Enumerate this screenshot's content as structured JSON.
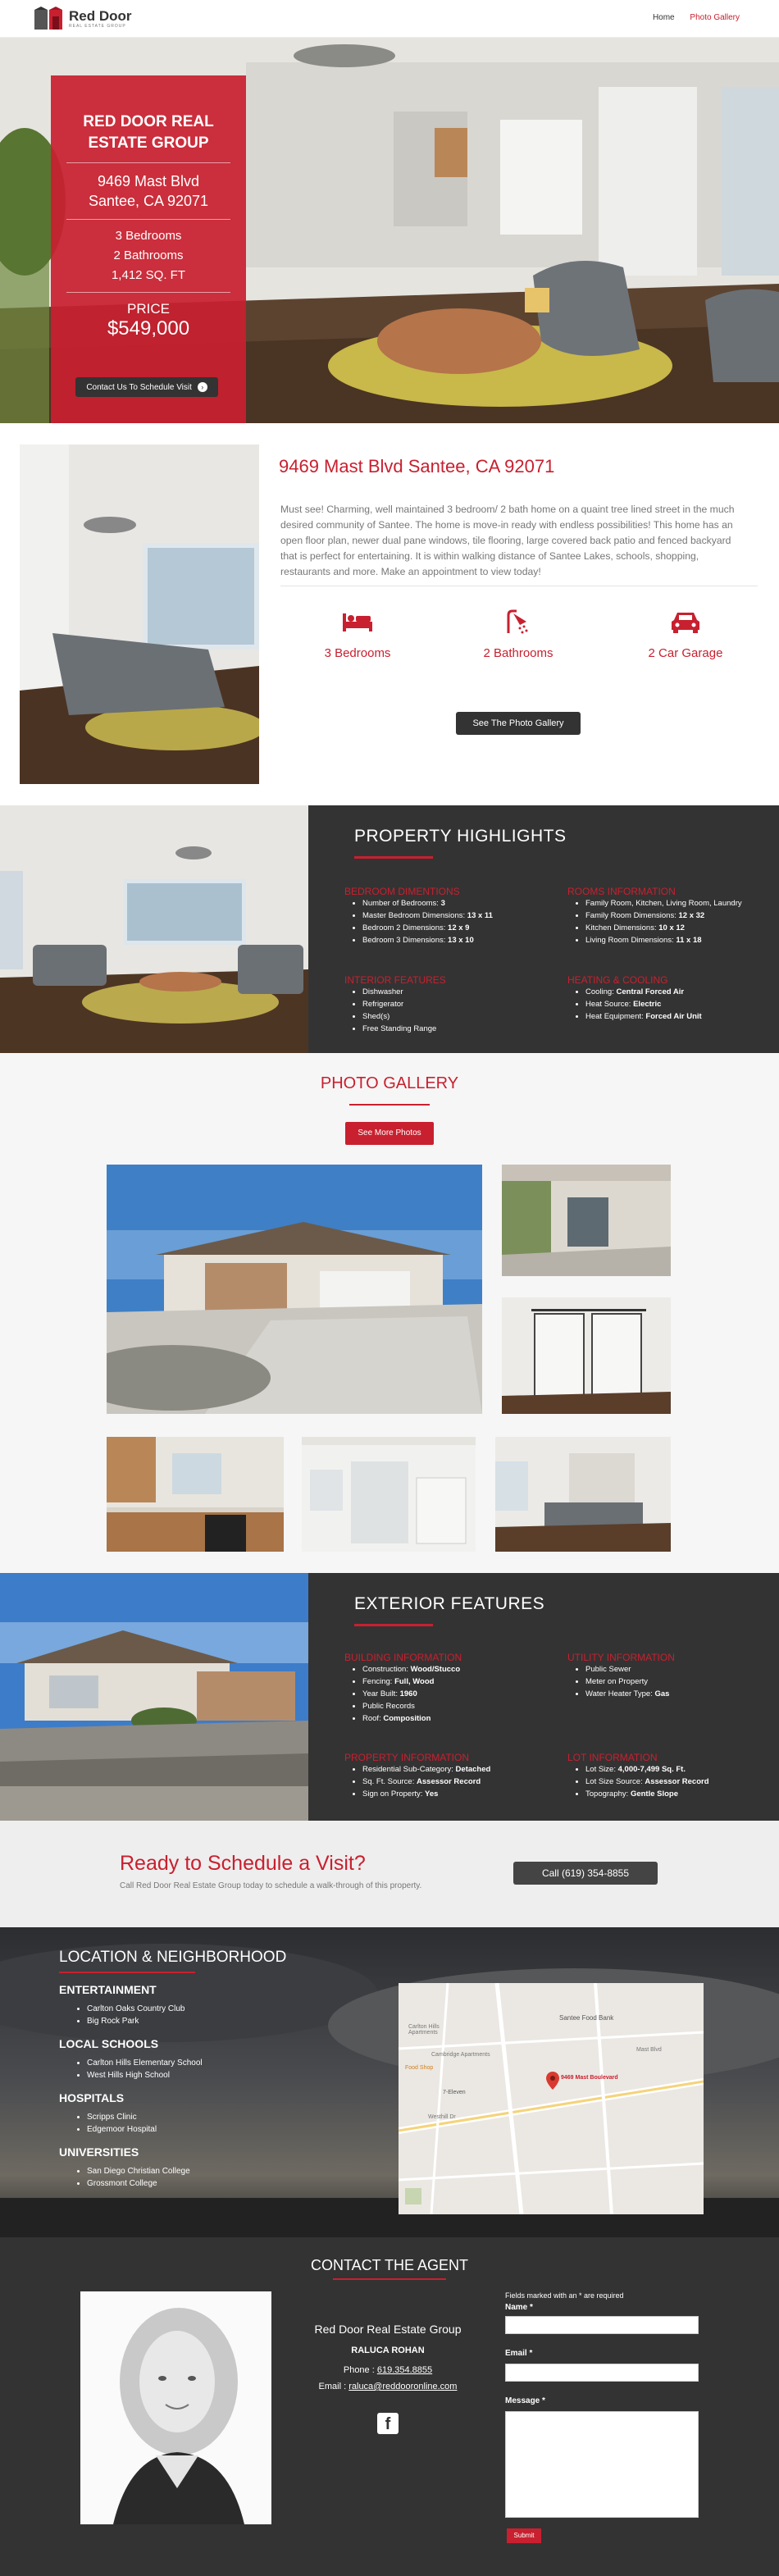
{
  "header": {
    "logo_text": "Red Door",
    "logo_sub": "REAL ESTATE GROUP",
    "nav": [
      "Home",
      "Photo Gallery"
    ]
  },
  "hero": {
    "title": "RED DOOR REAL ESTATE GROUP",
    "address_line1": "9469 Mast Blvd",
    "address_line2": "Santee, CA 92071",
    "beds": "3 Bedrooms",
    "baths": "2 Bathrooms",
    "sqft": "1,412 SQ. FT",
    "price_label": "PRICE",
    "price": "$549,000",
    "button": "Contact Us To Schedule Visit"
  },
  "overview": {
    "address": "9469 Mast Blvd Santee, CA 92071",
    "description": "Must see! Charming, well maintained 3 bedroom/ 2 bath home on a quaint tree lined street in the much desired community of Santee. The home is move-in ready with endless possibilities! This home has an open floor plan, newer dual pane windows, tile flooring, large covered back patio and fenced backyard that is perfect for entertaining. It is within walking distance of Santee Lakes, schools, shopping, restaurants and more. Make an appointment to view today!",
    "features": [
      {
        "icon": "bed-icon",
        "label": "3 Bedrooms"
      },
      {
        "icon": "shower-icon",
        "label": "2 Bathrooms"
      },
      {
        "icon": "car-icon",
        "label": "2 Car Garage"
      }
    ],
    "gallery_button": "See The Photo Gallery"
  },
  "highlights": {
    "title": "PROPERTY HIGHLIGHTS",
    "bedroom_dims": {
      "title": "BEDROOM DIMENTIONS",
      "items": [
        {
          "label": "Number of Bedrooms:",
          "value": "3"
        },
        {
          "label": "Master Bedroom Dimensions:",
          "value": "13 x 11"
        },
        {
          "label": "Bedroom 2 Dimensions:",
          "value": "12 x 9"
        },
        {
          "label": "Bedroom 3 Dimensions:",
          "value": "13 x 10"
        }
      ]
    },
    "rooms_info": {
      "title": "ROOMS INFORMATION",
      "items": [
        {
          "label": "Family Room, Kitchen, Living Room, Laundry",
          "value": ""
        },
        {
          "label": "Family Room Dimensions:",
          "value": "12 x 32"
        },
        {
          "label": "Kitchen Dimensions:",
          "value": "10 x 12"
        },
        {
          "label": "Living Room Dimensions:",
          "value": "11 x 18"
        }
      ]
    },
    "interior": {
      "title": "INTERIOR FEATURES",
      "items": [
        "Dishwasher",
        "Refrigerator",
        "Shed(s)",
        "Free Standing Range"
      ]
    },
    "heating": {
      "title": "HEATING & COOLING",
      "items": [
        {
          "label": "Cooling:",
          "value": "Central Forced Air"
        },
        {
          "label": "Heat Source:",
          "value": "Electric"
        },
        {
          "label": "Heat Equipment:",
          "value": "Forced Air Unit"
        }
      ]
    }
  },
  "gallery": {
    "title": "PHOTO GALLERY",
    "button": "See More Photos"
  },
  "exterior": {
    "title": "EXTERIOR FEATURES",
    "building": {
      "title": "BUILDING INFORMATION",
      "items": [
        {
          "label": "Construction:",
          "value": "Wood/Stucco"
        },
        {
          "label": "Fencing:",
          "value": "Full, Wood"
        },
        {
          "label": "Year Built:",
          "value": "1960"
        },
        {
          "label": "Public Records",
          "value": ""
        },
        {
          "label": "Roof:",
          "value": "Composition"
        }
      ]
    },
    "utility": {
      "title": "UTILITY INFORMATION",
      "items": [
        {
          "label": "Public Sewer",
          "value": ""
        },
        {
          "label": "Meter on Property",
          "value": ""
        },
        {
          "label": "Water Heater Type:",
          "value": "Gas"
        }
      ]
    },
    "property": {
      "title": "PROPERTY INFORMATION",
      "items": [
        {
          "label": "Residential Sub-Category:",
          "value": "Detached"
        },
        {
          "label": "Sq. Ft. Source:",
          "value": "Assessor Record"
        },
        {
          "label": "Sign on Property:",
          "value": "Yes"
        }
      ]
    },
    "lot": {
      "title": "LOT INFORMATION",
      "items": [
        {
          "label": "Lot Size:",
          "value": "4,000-7,499 Sq. Ft."
        },
        {
          "label": "Lot Size Source:",
          "value": "Assessor Record"
        },
        {
          "label": "Topography:",
          "value": "Gentle Slope"
        }
      ]
    }
  },
  "cta": {
    "title": "Ready to Schedule a Visit?",
    "subtitle": "Call Red Door Real Estate Group today to schedule a walk-through of this property.",
    "button": "Call (619) 354-8855"
  },
  "location": {
    "title": "LOCATION & NEIGHBORHOOD",
    "groups": [
      {
        "title": "ENTERTAINMENT",
        "items": [
          "Carlton Oaks Country Club",
          "Big Rock Park"
        ]
      },
      {
        "title": "LOCAL SCHOOLS",
        "items": [
          "Carlton Hills Elementary School",
          "West Hills High School"
        ]
      },
      {
        "title": "HOSPITALS",
        "items": [
          "Scripps Clinic",
          "Edgemoor Hospital"
        ]
      },
      {
        "title": "UNIVERSITIES",
        "items": [
          "San Diego Christian College",
          "Grossmont College"
        ]
      }
    ],
    "map_pin": "9469 Mast Boulevard",
    "map_labels": [
      "Santee Food Bank",
      "Carlton Hills Apartments",
      "Cambridge Apartments",
      "Mast Blvd",
      "7-Eleven",
      "Food Shop",
      "Westhill Dr"
    ]
  },
  "agent": {
    "title": "CONTACT THE AGENT",
    "company": "Red Door Real Estate Group",
    "name": "RALUCA ROHAN",
    "phone_label": "Phone :",
    "phone": "619.354.8855",
    "email_label": "Email :",
    "email": "raluca@reddooronline.com",
    "required_note": "Fields marked with an * are required",
    "name_field": "Name *",
    "email_field": "Email *",
    "message_field": "Message *",
    "submit": "Submit"
  }
}
